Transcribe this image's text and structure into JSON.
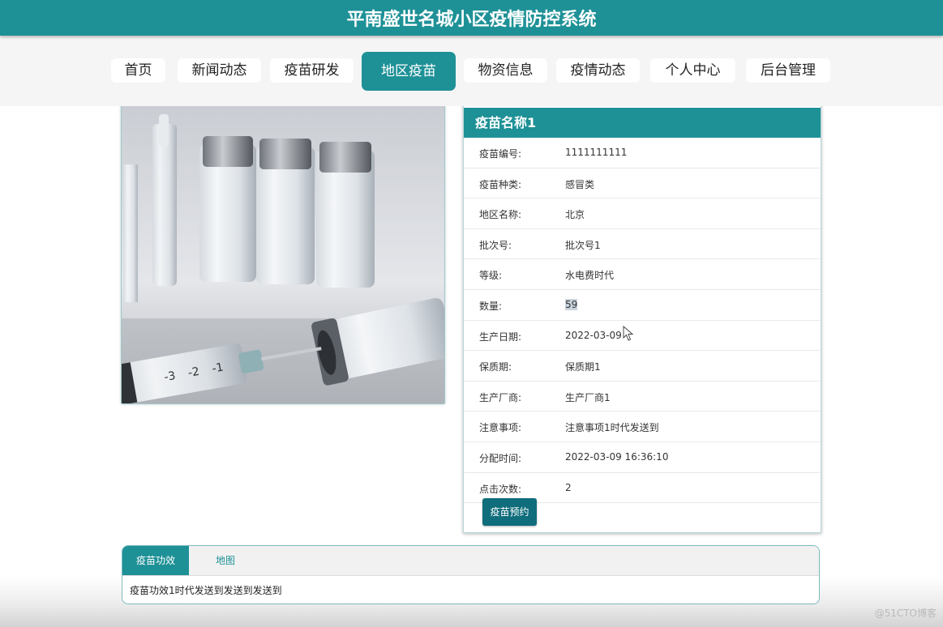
{
  "site": {
    "title": "平南盛世名城小区疫情防控系统"
  },
  "nav": {
    "items": [
      {
        "label": "首页"
      },
      {
        "label": "新闻动态"
      },
      {
        "label": "疫苗研发"
      },
      {
        "label": "地区疫苗"
      },
      {
        "label": "物资信息"
      },
      {
        "label": "疫情动态"
      },
      {
        "label": "个人中心"
      },
      {
        "label": "后台管理"
      }
    ],
    "active_label": "地区疫苗"
  },
  "detail": {
    "title": "疫苗名称1",
    "rows": [
      {
        "label": "疫苗编号:",
        "value": "1111111111"
      },
      {
        "label": "疫苗种类:",
        "value": "感冒类"
      },
      {
        "label": "地区名称:",
        "value": "北京"
      },
      {
        "label": "批次号:",
        "value": "批次号1"
      },
      {
        "label": "等级:",
        "value": "水电费时代"
      },
      {
        "label": "数量:",
        "value": "59"
      },
      {
        "label": "生产日期:",
        "value": "2022-03-09"
      },
      {
        "label": "保质期:",
        "value": "保质期1"
      },
      {
        "label": "生产厂商:",
        "value": "生产厂商1"
      },
      {
        "label": "注意事项:",
        "value": "注意事项1时代发送到"
      },
      {
        "label": "分配时间:",
        "value": "2022-03-09 16:36:10"
      },
      {
        "label": "点击次数:",
        "value": "2"
      }
    ],
    "reserve_button": "疫苗预约"
  },
  "tabs": {
    "items": [
      {
        "label": "疫苗功效"
      },
      {
        "label": "地图"
      }
    ],
    "content": "疫苗功效1时代发送到发送到发送到"
  },
  "watermark": "@51CTO博客",
  "colors": {
    "primary": "#1e9197",
    "button": "#0f6d7c",
    "nav_bg": "#f5f5f5"
  }
}
